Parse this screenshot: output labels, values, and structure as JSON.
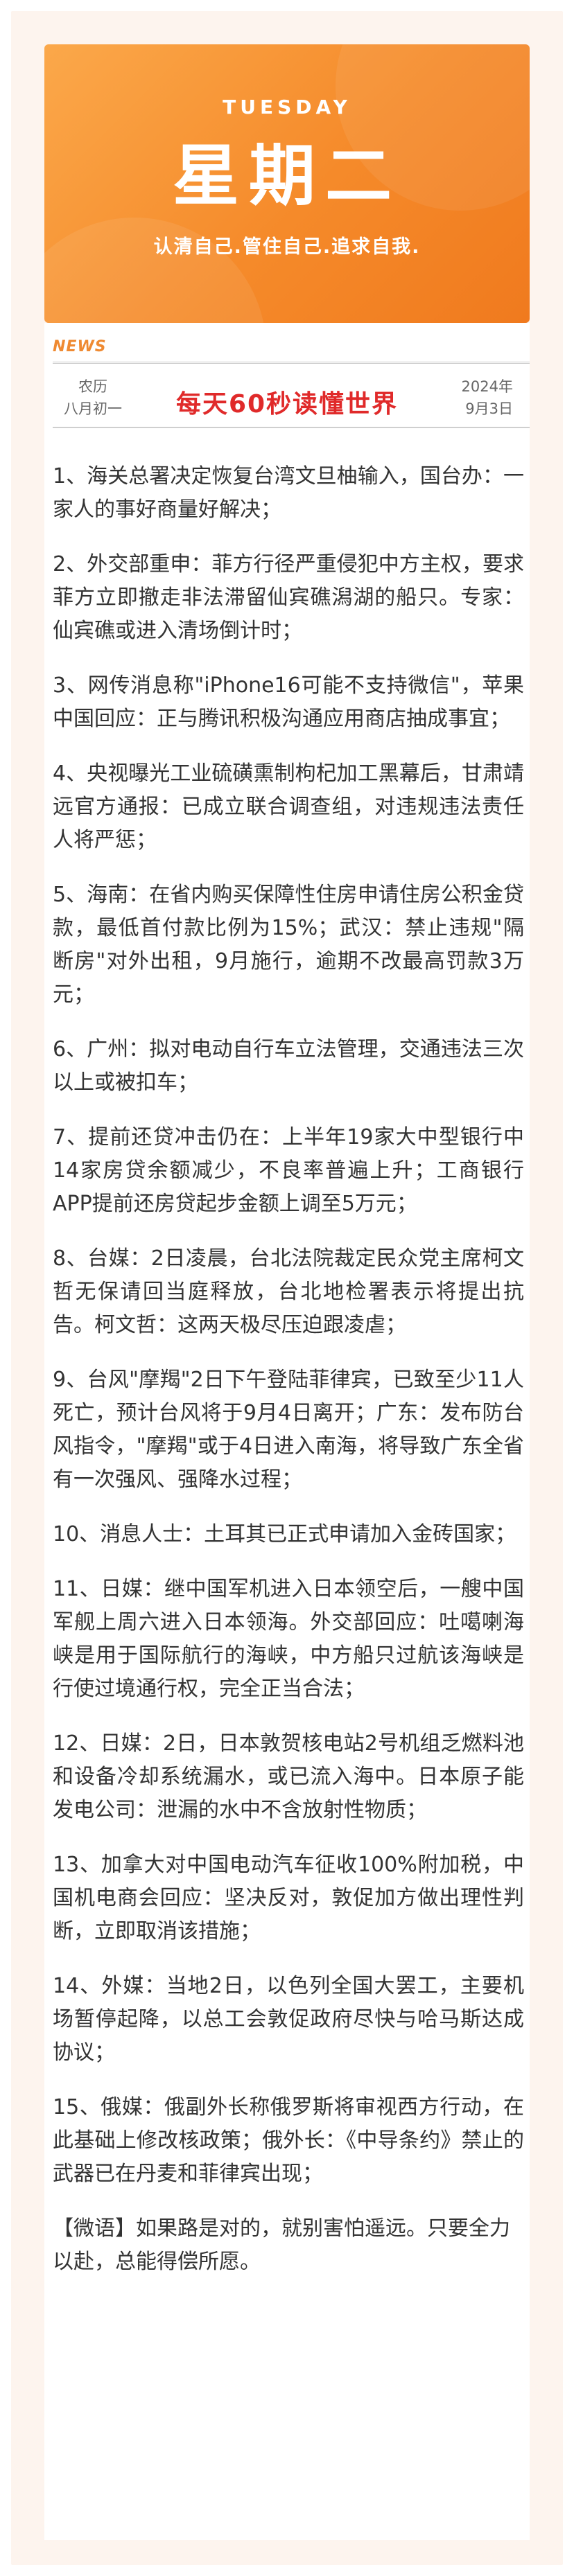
{
  "banner": {
    "weekday_en": "TUESDAY",
    "weekday_cn": "星期二",
    "slogan": "认清自己.管住自己.追求自我."
  },
  "header": {
    "tag": "NEWS",
    "lunar_label": "农历",
    "lunar_date": "八月初一",
    "title": "每天60秒读懂世界",
    "year": "2024年",
    "date": "9月3日"
  },
  "colors": {
    "banner_orange": "#f58a2a",
    "title_red": "#e02a2a",
    "tag_orange": "#ef8a32",
    "frame_bg": "#fdf4ee"
  },
  "news": [
    "1、海关总署决定恢复台湾文旦柚输入，国台办：一家人的事好商量好解决；",
    "2、外交部重申：菲方行径严重侵犯中方主权，要求菲方立即撤走非法滞留仙宾礁潟湖的船只。专家：仙宾礁或进入清场倒计时；",
    "3、网传消息称\"iPhone16可能不支持微信\"，苹果中国回应：正与腾讯积极沟通应用商店抽成事宜；",
    "4、央视曝光工业硫磺熏制枸杞加工黑幕后，甘肃靖远官方通报：已成立联合调查组，对违规违法责任人将严惩；",
    "5、海南：在省内购买保障性住房申请住房公积金贷款，最低首付款比例为15%；武汉：禁止违规\"隔断房\"对外出租，9月施行，逾期不改最高罚款3万元；",
    "6、广州：拟对电动自行车立法管理，交通违法三次以上或被扣车；",
    "7、提前还贷冲击仍在：上半年19家大中型银行中14家房贷余额减少，不良率普遍上升；工商银行APP提前还房贷起步金额上调至5万元；",
    "8、台媒：2日凌晨，台北法院裁定民众党主席柯文哲无保请回当庭释放，台北地检署表示将提出抗告。柯文哲：这两天极尽压迫跟凌虐；",
    "9、台风\"摩羯\"2日下午登陆菲律宾，已致至少11人死亡，预计台风将于9月4日离开；广东：发布防台风指令，\"摩羯\"或于4日进入南海，将导致广东全省有一次强风、强降水过程；",
    "10、消息人士：土耳其已正式申请加入金砖国家；",
    "11、日媒：继中国军机进入日本领空后，一艘中国军舰上周六进入日本领海。外交部回应：吐噶喇海峡是用于国际航行的海峡，中方船只过航该海峡是行使过境通行权，完全正当合法；",
    "12、日媒：2日，日本敦贺核电站2号机组乏燃料池和设备冷却系统漏水，或已流入海中。日本原子能发电公司：泄漏的水中不含放射性物质；",
    "13、加拿大对中国电动汽车征收100%附加税，中国机电商会回应：坚决反对，敦促加方做出理性判断，立即取消该措施；",
    "14、外媒：当地2日，以色列全国大罢工，主要机场暂停起降，以总工会敦促政府尽快与哈马斯达成协议；",
    "15、俄媒：俄副外长称俄罗斯将审视西方行动，在此基础上修改核政策；俄外长：《中导条约》禁止的武器已在丹麦和菲律宾出现；"
  ],
  "quote": "【微语】如果路是对的，就别害怕遥远。只要全力以赴，总能得偿所愿。"
}
